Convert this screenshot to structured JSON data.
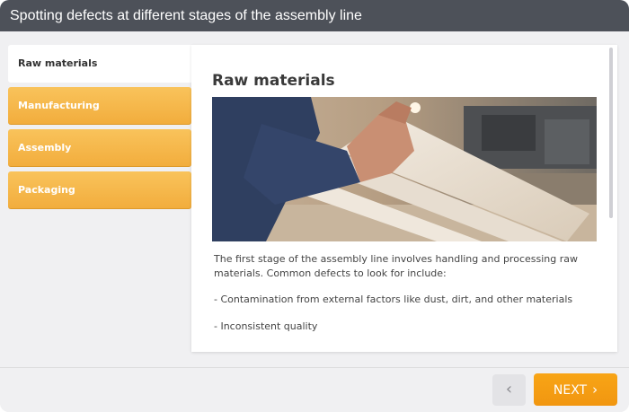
{
  "window": {
    "title": "Spotting defects at different stages of the assembly line"
  },
  "tabs": [
    {
      "label": "Raw materials",
      "active": true
    },
    {
      "label": "Manufacturing",
      "active": false
    },
    {
      "label": "Assembly",
      "active": false
    },
    {
      "label": "Packaging",
      "active": false
    }
  ],
  "panel": {
    "title": "Raw materials",
    "paragraphs": [
      "The first stage of the assembly line involves handling and processing raw materials. Common defects to look for include:",
      "- Contamination from external factors like dust, dirt, and other materials",
      "- Inconsistent quality"
    ]
  },
  "navigation": {
    "prev_icon": "chevron-left-icon",
    "prev_glyph": "‹",
    "next_label": "NEXT",
    "next_icon": "chevron-right-icon",
    "next_glyph": "›"
  },
  "colors": {
    "titlebar": "#4d5159",
    "tab_active_bg": "#ffffff",
    "tab_inactive_bg": "#f4b445",
    "next_button_bg": "#f39c12"
  }
}
